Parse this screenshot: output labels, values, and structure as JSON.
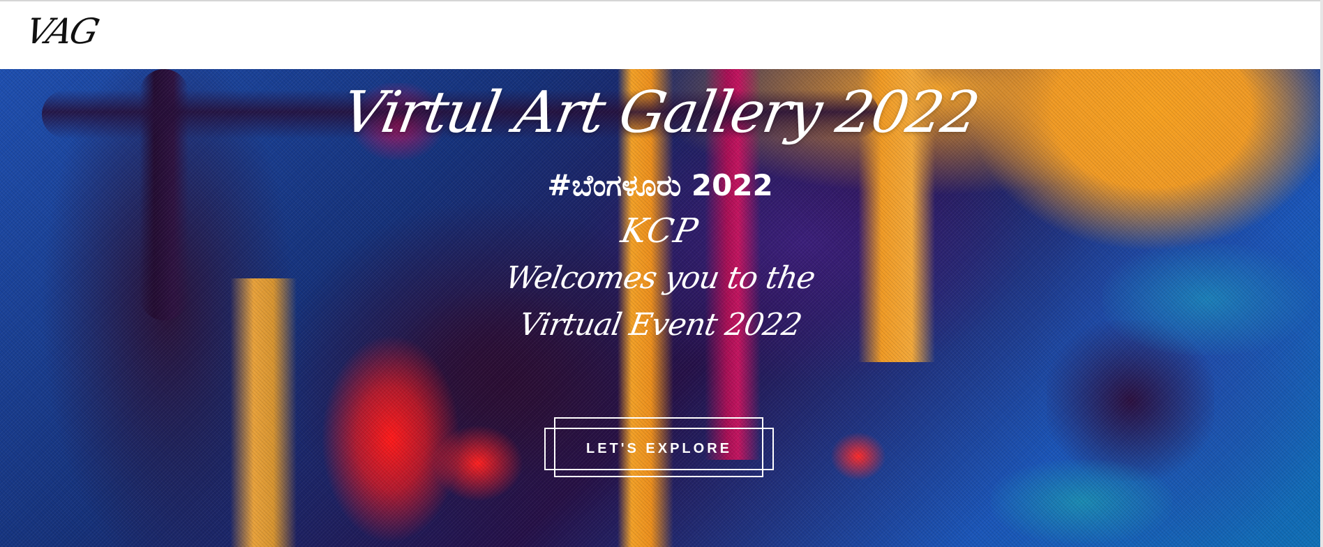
{
  "header": {
    "logo": "VAG"
  },
  "hero": {
    "title": "Virtul Art Gallery 2022",
    "subtitle": "#ಬೆಂಗಳೂರು 2022",
    "organizer": "KCP",
    "welcome_line": "Welcomes you to the",
    "event_line": "Virtual Event 2022",
    "cta_label": "LET'S EXPLORE"
  },
  "colors": {
    "header_background": "#ffffff",
    "hero_text": "#ffffff",
    "paint_blue": "#1e4fb0",
    "paint_purple": "#2a1238",
    "paint_orange": "#f4a32b",
    "paint_red": "#ff1a1a",
    "paint_magenta": "#b0105a"
  }
}
